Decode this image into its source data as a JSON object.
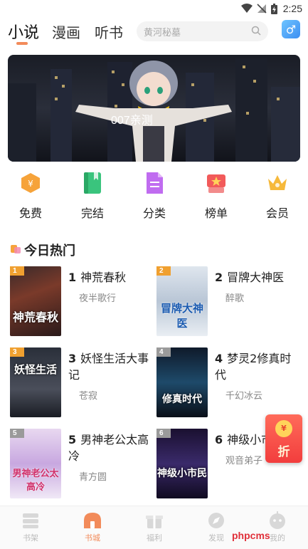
{
  "status_bar": {
    "time": "2:25",
    "icons": [
      "wifi-icon",
      "signal-off-icon",
      "battery-charging-icon"
    ]
  },
  "top_nav": {
    "tabs": [
      {
        "label": "小说",
        "active": true
      },
      {
        "label": "漫画",
        "active": false
      },
      {
        "label": "听书",
        "active": false
      }
    ],
    "search_placeholder": "黄河秘墓",
    "gender_icon": "male-icon",
    "gender_glyph": "♂"
  },
  "banner": {
    "caption": "007亲测"
  },
  "quick_entries": [
    {
      "label": "免费",
      "icon": "coin-hexagon-icon",
      "color": "#f6a33a"
    },
    {
      "label": "完结",
      "icon": "book-icon",
      "color": "#3ac47d"
    },
    {
      "label": "分类",
      "icon": "document-icon",
      "color": "#c06cf0"
    },
    {
      "label": "榜单",
      "icon": "star-ribbon-icon",
      "color": "#f25a5a"
    },
    {
      "label": "会员",
      "icon": "crown-icon",
      "color": "#f6b93b"
    }
  ],
  "section": {
    "title": "今日热门"
  },
  "books": [
    {
      "rank": "1",
      "num": "1",
      "title": "神荒春秋",
      "author": "夜半歌行",
      "cover_text": "神荒春秋",
      "rank_color": "#f0a030"
    },
    {
      "rank": "2",
      "num": "2",
      "title": "冒牌大神医",
      "author": "醉歌",
      "cover_text": "冒牌大神医",
      "rank_color": "#f0a030"
    },
    {
      "rank": "3",
      "num": "3",
      "title": "妖怪生活大事记",
      "author": "苍寂",
      "cover_text": "妖怪生活",
      "rank_color": "#f0a030"
    },
    {
      "rank": "4",
      "num": "4",
      "title": "梦灵2修真时代",
      "author": "千幻冰云",
      "cover_text": "修真时代",
      "rank_color": "#9a9a9a"
    },
    {
      "rank": "5",
      "num": "5",
      "title": "男神老公太高冷",
      "author": "青方圆",
      "cover_text": "男神老公太高冷",
      "rank_color": "#9a9a9a"
    },
    {
      "rank": "6",
      "num": "6",
      "title": "神级小市民",
      "author": "观音弟子",
      "cover_text": "神级小市民",
      "rank_color": "#9a9a9a"
    }
  ],
  "red_envelope": {
    "label": "折",
    "coin": "¥"
  },
  "bottom_nav": [
    {
      "label": "书架",
      "icon": "bookshelf-icon",
      "active": false
    },
    {
      "label": "书城",
      "icon": "store-icon",
      "active": true
    },
    {
      "label": "福利",
      "icon": "gift-icon",
      "active": false
    },
    {
      "label": "发现",
      "icon": "discover-icon",
      "active": false
    },
    {
      "label": "我的",
      "icon": "profile-icon",
      "active": false
    }
  ],
  "watermark": "phpcms"
}
